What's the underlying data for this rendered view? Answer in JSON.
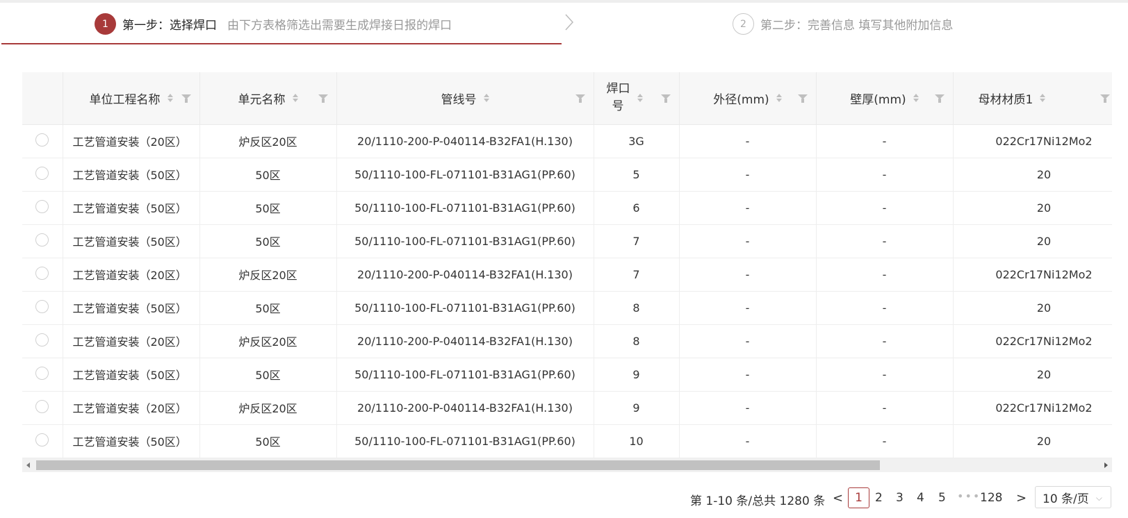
{
  "steps": {
    "step1": {
      "number": "1",
      "title": "第一步：选择焊口",
      "description": "由下方表格筛选出需要生成焊接日报的焊口"
    },
    "step2": {
      "number": "2",
      "title": "第二步：完善信息  填写其他附加信息"
    }
  },
  "table": {
    "columns": [
      "单位工程名称",
      "单元名称",
      "管线号",
      "焊口号",
      "外径(mm)",
      "壁厚(mm)",
      "母材材质1"
    ],
    "weld_col_line1": "焊口",
    "weld_col_line2": "号",
    "rows": [
      [
        "工艺管道安装（20区）",
        "炉反区20区",
        "20/1110-200-P-040114-B32FA1(H.130)",
        "3G",
        "-",
        "-",
        "022Cr17Ni12Mo2"
      ],
      [
        "工艺管道安装（50区）",
        "50区",
        "50/1110-100-FL-071101-B31AG1(PP.60)",
        "5",
        "-",
        "-",
        "20"
      ],
      [
        "工艺管道安装（50区）",
        "50区",
        "50/1110-100-FL-071101-B31AG1(PP.60)",
        "6",
        "-",
        "-",
        "20"
      ],
      [
        "工艺管道安装（50区）",
        "50区",
        "50/1110-100-FL-071101-B31AG1(PP.60)",
        "7",
        "-",
        "-",
        "20"
      ],
      [
        "工艺管道安装（20区）",
        "炉反区20区",
        "20/1110-200-P-040114-B32FA1(H.130)",
        "7",
        "-",
        "-",
        "022Cr17Ni12Mo2"
      ],
      [
        "工艺管道安装（50区）",
        "50区",
        "50/1110-100-FL-071101-B31AG1(PP.60)",
        "8",
        "-",
        "-",
        "20"
      ],
      [
        "工艺管道安装（20区）",
        "炉反区20区",
        "20/1110-200-P-040114-B32FA1(H.130)",
        "8",
        "-",
        "-",
        "022Cr17Ni12Mo2"
      ],
      [
        "工艺管道安装（50区）",
        "50区",
        "50/1110-100-FL-071101-B31AG1(PP.60)",
        "9",
        "-",
        "-",
        "20"
      ],
      [
        "工艺管道安装（20区）",
        "炉反区20区",
        "20/1110-200-P-040114-B32FA1(H.130)",
        "9",
        "-",
        "-",
        "022Cr17Ni12Mo2"
      ],
      [
        "工艺管道安装（50区）",
        "50区",
        "50/1110-100-FL-071101-B31AG1(PP.60)",
        "10",
        "-",
        "-",
        "20"
      ]
    ]
  },
  "pagination": {
    "total_text": "第 1-10 条/总共 1280 条",
    "prev": "<",
    "next": ">",
    "pages": [
      "1",
      "2",
      "3",
      "4",
      "5"
    ],
    "ellipsis": "•••",
    "last_page": "128",
    "page_size": "10 条/页"
  },
  "colors": {
    "accent": "#a83a3a"
  },
  "icons": [
    "sort-icon",
    "filter-icon",
    "chevron-right-icon",
    "chevron-down-icon"
  ]
}
